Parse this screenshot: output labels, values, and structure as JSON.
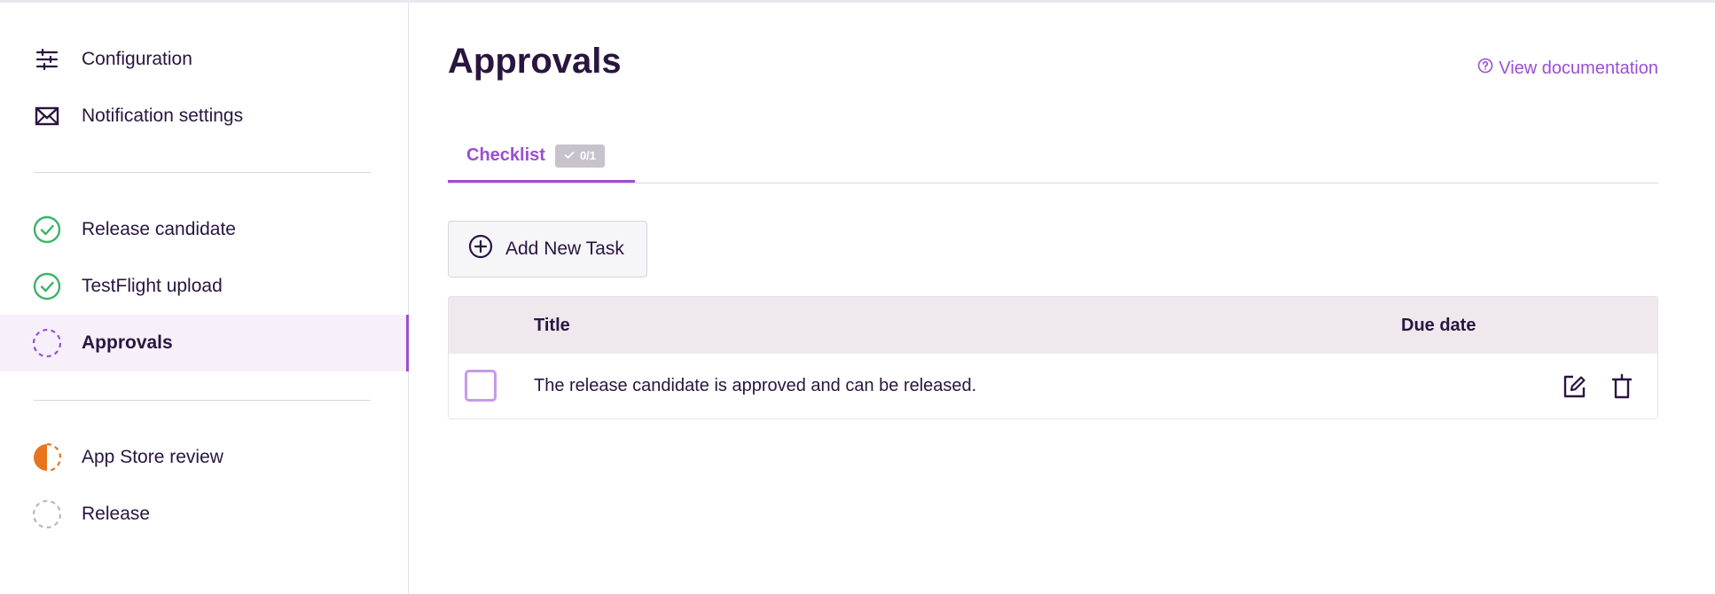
{
  "sidebar": {
    "top_items": [
      {
        "label": "Configuration",
        "icon": "sliders-icon"
      },
      {
        "label": "Notification settings",
        "icon": "envelope-icon"
      }
    ],
    "steps": [
      {
        "label": "Release candidate",
        "icon": "check-circle-icon",
        "status": "done"
      },
      {
        "label": "TestFlight upload",
        "icon": "check-circle-icon",
        "status": "done"
      },
      {
        "label": "Approvals",
        "icon": "dashed-circle-icon",
        "status": "active"
      }
    ],
    "bottom_steps": [
      {
        "label": "App Store review",
        "icon": "half-circle-icon",
        "status": "in-progress"
      },
      {
        "label": "Release",
        "icon": "dashed-circle-icon",
        "status": "pending"
      }
    ]
  },
  "main": {
    "title": "Approvals",
    "doc_link": "View documentation",
    "tabs": [
      {
        "label": "Checklist",
        "badge": "0/1",
        "selected": true
      }
    ],
    "add_button": "Add New Task",
    "table": {
      "columns": [
        "Title",
        "Due date"
      ],
      "rows": [
        {
          "title": "The release candidate is approved and can be released.",
          "due_date": "",
          "checked": false
        }
      ]
    }
  },
  "colors": {
    "accent": "#9b4fd1",
    "text": "#2a1540",
    "done": "#3db36b",
    "in_progress": "#e8741e",
    "pending": "#b8b8b8"
  }
}
